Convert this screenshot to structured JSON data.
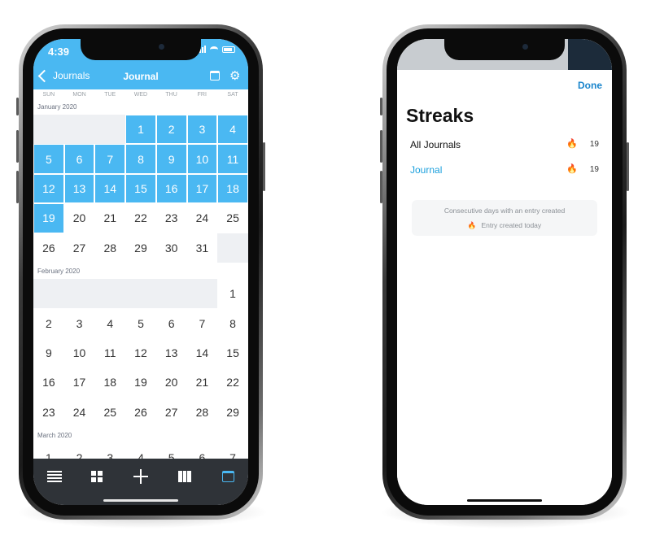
{
  "calendar_app": {
    "status": {
      "time": "4:39"
    },
    "nav": {
      "back_label": "Journals",
      "title": "Journal"
    },
    "weekdays": [
      "SUN",
      "MON",
      "TUE",
      "WED",
      "THU",
      "FRI",
      "SAT"
    ],
    "months": [
      {
        "label": "January 2020",
        "leading_empty": 3,
        "days": [
          "1",
          "2",
          "3",
          "4",
          "5",
          "6",
          "7",
          "8",
          "9",
          "10",
          "11",
          "12",
          "13",
          "14",
          "15",
          "16",
          "17",
          "18",
          "19",
          "20",
          "21",
          "22",
          "23",
          "24",
          "25",
          "26",
          "27",
          "28",
          "29",
          "30",
          "31"
        ],
        "highlighted_through": 19,
        "trailing_empty": 1
      },
      {
        "label": "February 2020",
        "leading_empty": 6,
        "days": [
          "1",
          "2",
          "3",
          "4",
          "5",
          "6",
          "7",
          "8",
          "9",
          "10",
          "11",
          "12",
          "13",
          "14",
          "15",
          "16",
          "17",
          "18",
          "19",
          "20",
          "21",
          "22",
          "23",
          "24",
          "25",
          "26",
          "27",
          "28",
          "29"
        ],
        "highlighted_through": 0,
        "trailing_empty": 0
      },
      {
        "label": "March 2020",
        "leading_empty": 0,
        "days": [
          "1",
          "2",
          "3",
          "4",
          "5",
          "6",
          "7"
        ],
        "highlighted_through": 0,
        "trailing_empty": 0
      }
    ],
    "tabs": [
      {
        "name": "list-icon"
      },
      {
        "name": "grid-icon"
      },
      {
        "name": "add-icon"
      },
      {
        "name": "map-icon"
      },
      {
        "name": "calendar-icon",
        "active": true
      }
    ],
    "accent_color": "#4ab8f2",
    "tabbar_color": "#2f3338"
  },
  "streaks_sheet": {
    "done_label": "Done",
    "title": "Streaks",
    "rows": [
      {
        "name": "All Journals",
        "count": "19",
        "accent": false
      },
      {
        "name": "Journal",
        "count": "19",
        "accent": true
      }
    ],
    "legend": {
      "line1": "Consecutive days with an entry created",
      "line2": "Entry created today"
    },
    "link_color": "#1a85cc",
    "fire_color": "#f5a623"
  }
}
